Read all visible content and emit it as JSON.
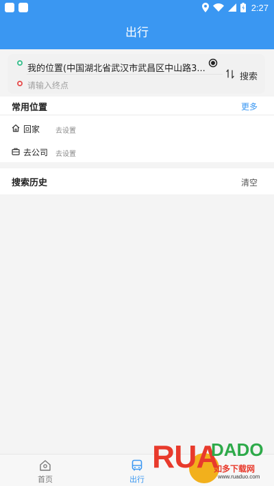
{
  "status_bar": {
    "time": "2:27"
  },
  "header": {
    "title": "出行"
  },
  "search": {
    "start_location": "我的位置(中国湖北省武汉市武昌区中山路3...",
    "destination_placeholder": "请输入终点",
    "search_label": "搜索"
  },
  "frequent": {
    "title": "常用位置",
    "more_label": "更多",
    "items": [
      {
        "label": "回家",
        "sub": "去设置",
        "icon": "home-icon"
      },
      {
        "label": "去公司",
        "sub": "去设置",
        "icon": "briefcase-icon"
      }
    ]
  },
  "history": {
    "title": "搜索历史",
    "clear_label": "清空"
  },
  "bottom_nav": {
    "items": [
      {
        "label": "首页",
        "icon": "home-icon",
        "active": false
      },
      {
        "label": "出行",
        "icon": "bus-icon",
        "active": true
      }
    ],
    "active_color": "#3a97f2"
  },
  "watermark": {
    "brand": "RUANDADO",
    "cn": "如多下载网",
    "url": "www.ruaduo.com"
  },
  "colors": {
    "primary": "#3a97f2",
    "start_dot": "#3cbf8f",
    "end_dot": "#e55353",
    "background": "#f4f4f4"
  }
}
